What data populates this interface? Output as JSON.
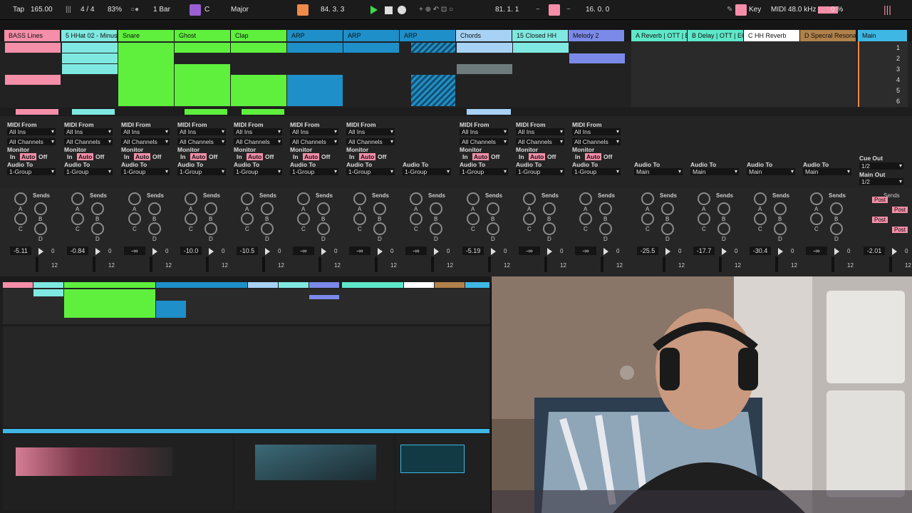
{
  "transport": {
    "tap": "Tap",
    "tempo": "165.00",
    "meter": "4 / 4",
    "zoom": "83%",
    "quant": "1 Bar",
    "key": "C",
    "scale": "Major",
    "position": "84.  3.  3",
    "loop_start": "81.  1.  1",
    "loop_length": "16.  0.  0",
    "key_label": "Key",
    "midi_label": "MIDI",
    "sample_rate": "48.0 kHz",
    "cpu": "0 %"
  },
  "tracks": [
    {
      "name": "BASS Lines",
      "color": "#f58ea9"
    },
    {
      "name": "5 HHat 02 - Minus",
      "color": "#7fe9e1"
    },
    {
      "name": "Snare",
      "color": "#5ef03d"
    },
    {
      "name": "Ghost",
      "color": "#5ef03d"
    },
    {
      "name": "Clap",
      "color": "#5ef03d"
    },
    {
      "name": "ARP",
      "color": "#1e8fc8"
    },
    {
      "name": "ARP",
      "color": "#1e8fc8"
    },
    {
      "name": "ARP",
      "color": "#1e8fc8"
    },
    {
      "name": "Chords",
      "color": "#a7d2f5"
    },
    {
      "name": "15 Closed HH",
      "color": "#7fe9e1"
    },
    {
      "name": "Melody 2",
      "color": "#7b8ae8"
    },
    {
      "name": "A Reverb | OTT | E",
      "color": "#5ee8c9"
    },
    {
      "name": "B Delay | OTT | EQ",
      "color": "#5ee8c9"
    },
    {
      "name": "C HH Reverb",
      "color": "#ffffff"
    },
    {
      "name": "D Specral Resona",
      "color": "#b0814a"
    },
    {
      "name": "Main",
      "color": "#3fb7e4"
    }
  ],
  "scenes": [
    "1",
    "2",
    "3",
    "4",
    "5",
    "6"
  ],
  "io": {
    "midi_from": "MIDI From",
    "all_ins": "All Ins",
    "all_channels": "All Channels",
    "monitor": "Monitor",
    "in": "In",
    "auto": "Auto",
    "off": "Off",
    "audio_to": "Audio To",
    "group": "1-Group",
    "main": "Main",
    "cue_out": "Cue Out",
    "cue_val": "1/2",
    "main_out": "Main Out",
    "main_val": "1/2"
  },
  "sends_label": "Sends",
  "send_letters": [
    "A",
    "B",
    "C",
    "D"
  ],
  "post": "Post",
  "volumes": [
    "-5.11",
    "-0.84",
    "-∞",
    "-10.0",
    "-10.5",
    "-∞",
    "-∞",
    "-∞",
    "-5.19",
    "-∞",
    "-∞",
    "-25.5",
    "-17.7",
    "-30.4",
    "-∞",
    "-2.01"
  ],
  "fader_scale": [
    "0",
    "12"
  ],
  "colors": {
    "pink": "#f58ea9",
    "cyan": "#7fe9e1",
    "green": "#5ef03d",
    "blue": "#1e8fc8",
    "orange": "#f08a4b"
  }
}
